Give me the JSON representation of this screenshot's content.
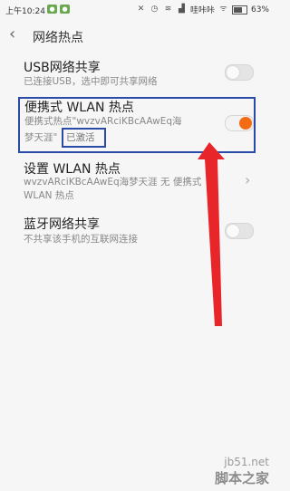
{
  "status_bar": {
    "time": "上午10:24",
    "carrier": "哇咔咔",
    "battery": "63%"
  },
  "header": {
    "title": "网络热点"
  },
  "items": [
    {
      "label": "USB网络共享",
      "sub": "已连接USB，选中即可共享网络",
      "toggle": "off"
    },
    {
      "label": "便携式 WLAN 热点",
      "sub_line1": "便携式热点\"wvzvARciKBcAAwEq海",
      "sub_line2": "梦天涯\"",
      "status": "已激活",
      "toggle": "on"
    },
    {
      "label": "设置 WLAN 热点",
      "sub": "wvzvARciKBcAAwEq海梦天涯 无 便携式WLAN 热点"
    },
    {
      "label": "蓝牙网络共享",
      "sub": "不共享该手机的互联网连接",
      "toggle": "off"
    }
  ],
  "watermark": {
    "site": "jb51.net",
    "brand": "脚本之家"
  }
}
